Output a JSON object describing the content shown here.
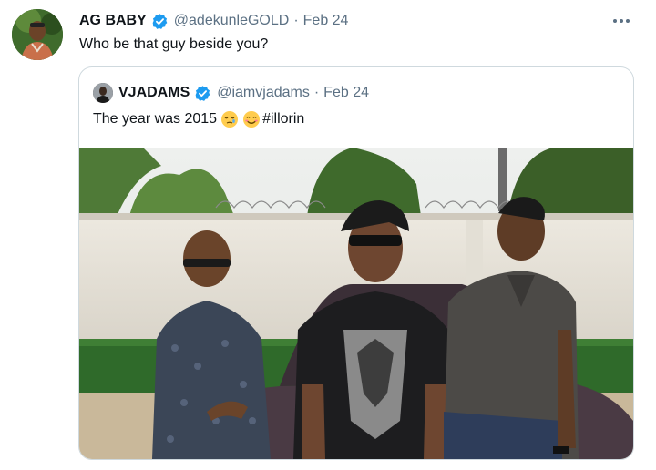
{
  "tweet": {
    "author": {
      "display_name": "AG BABY",
      "handle": "@adekunleGOLD",
      "verified": true,
      "avatar_icon": "profile-photo"
    },
    "separator": "·",
    "date": "Feb 24",
    "text": "Who be that guy beside you?",
    "more_icon": "more-horizontal-icon"
  },
  "quoted": {
    "author": {
      "display_name": "VJADAMS",
      "handle": "@iamvjadams",
      "verified": true,
      "avatar_icon": "profile-photo"
    },
    "separator": "·",
    "date": "Feb 24",
    "text": "The year was 2015",
    "emojis": [
      "sleepy-face",
      "smiling-face-with-smiling-eyes"
    ],
    "hashtag": "#illorin",
    "media": {
      "type": "photo",
      "subject_icon": "three-men-in-front-of-wall-photo"
    }
  },
  "colors": {
    "text_primary": "#0f1419",
    "text_secondary": "#5b7083",
    "verified_blue": "#1d9bf0",
    "card_border": "#cfd9de"
  }
}
